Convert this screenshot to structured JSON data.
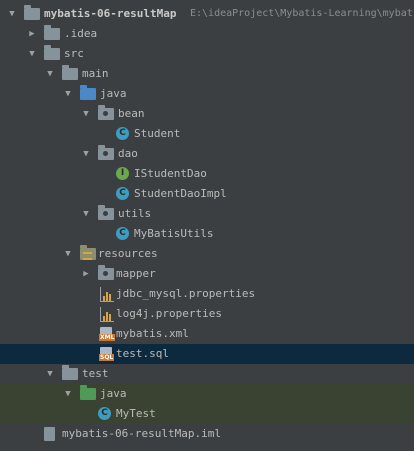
{
  "project": {
    "name": "mybatis-06-resultMap",
    "path": "E:\\ideaProject\\Mybatis-Learning\\mybat"
  },
  "nodes": {
    "idea": ".idea",
    "src": "src",
    "main": "main",
    "java": "java",
    "bean": "bean",
    "student": "Student",
    "dao": "dao",
    "istudentdao": "IStudentDao",
    "studentdaoimpl": "StudentDaoImpl",
    "utils": "utils",
    "mybatisutils": "MyBatisUtils",
    "resources": "resources",
    "mapper": "mapper",
    "jdbc": "jdbc_mysql.properties",
    "log4j": "log4j.properties",
    "mybatisxml": "mybatis.xml",
    "testsql": "test.sql",
    "test": "test",
    "testjava": "java",
    "mytest": "MyTest",
    "iml": "mybatis-06-resultMap.iml"
  },
  "icons": {
    "class_letter": "C",
    "interface_letter": "I",
    "xml_badge": "XML",
    "sql_badge": "SQL"
  },
  "colors": {
    "background": "#3c3f41",
    "selection": "#0d293e",
    "test_source_row": "#3a4331",
    "source_folder": "#4a88c7",
    "test_folder": "#4e9a56"
  }
}
